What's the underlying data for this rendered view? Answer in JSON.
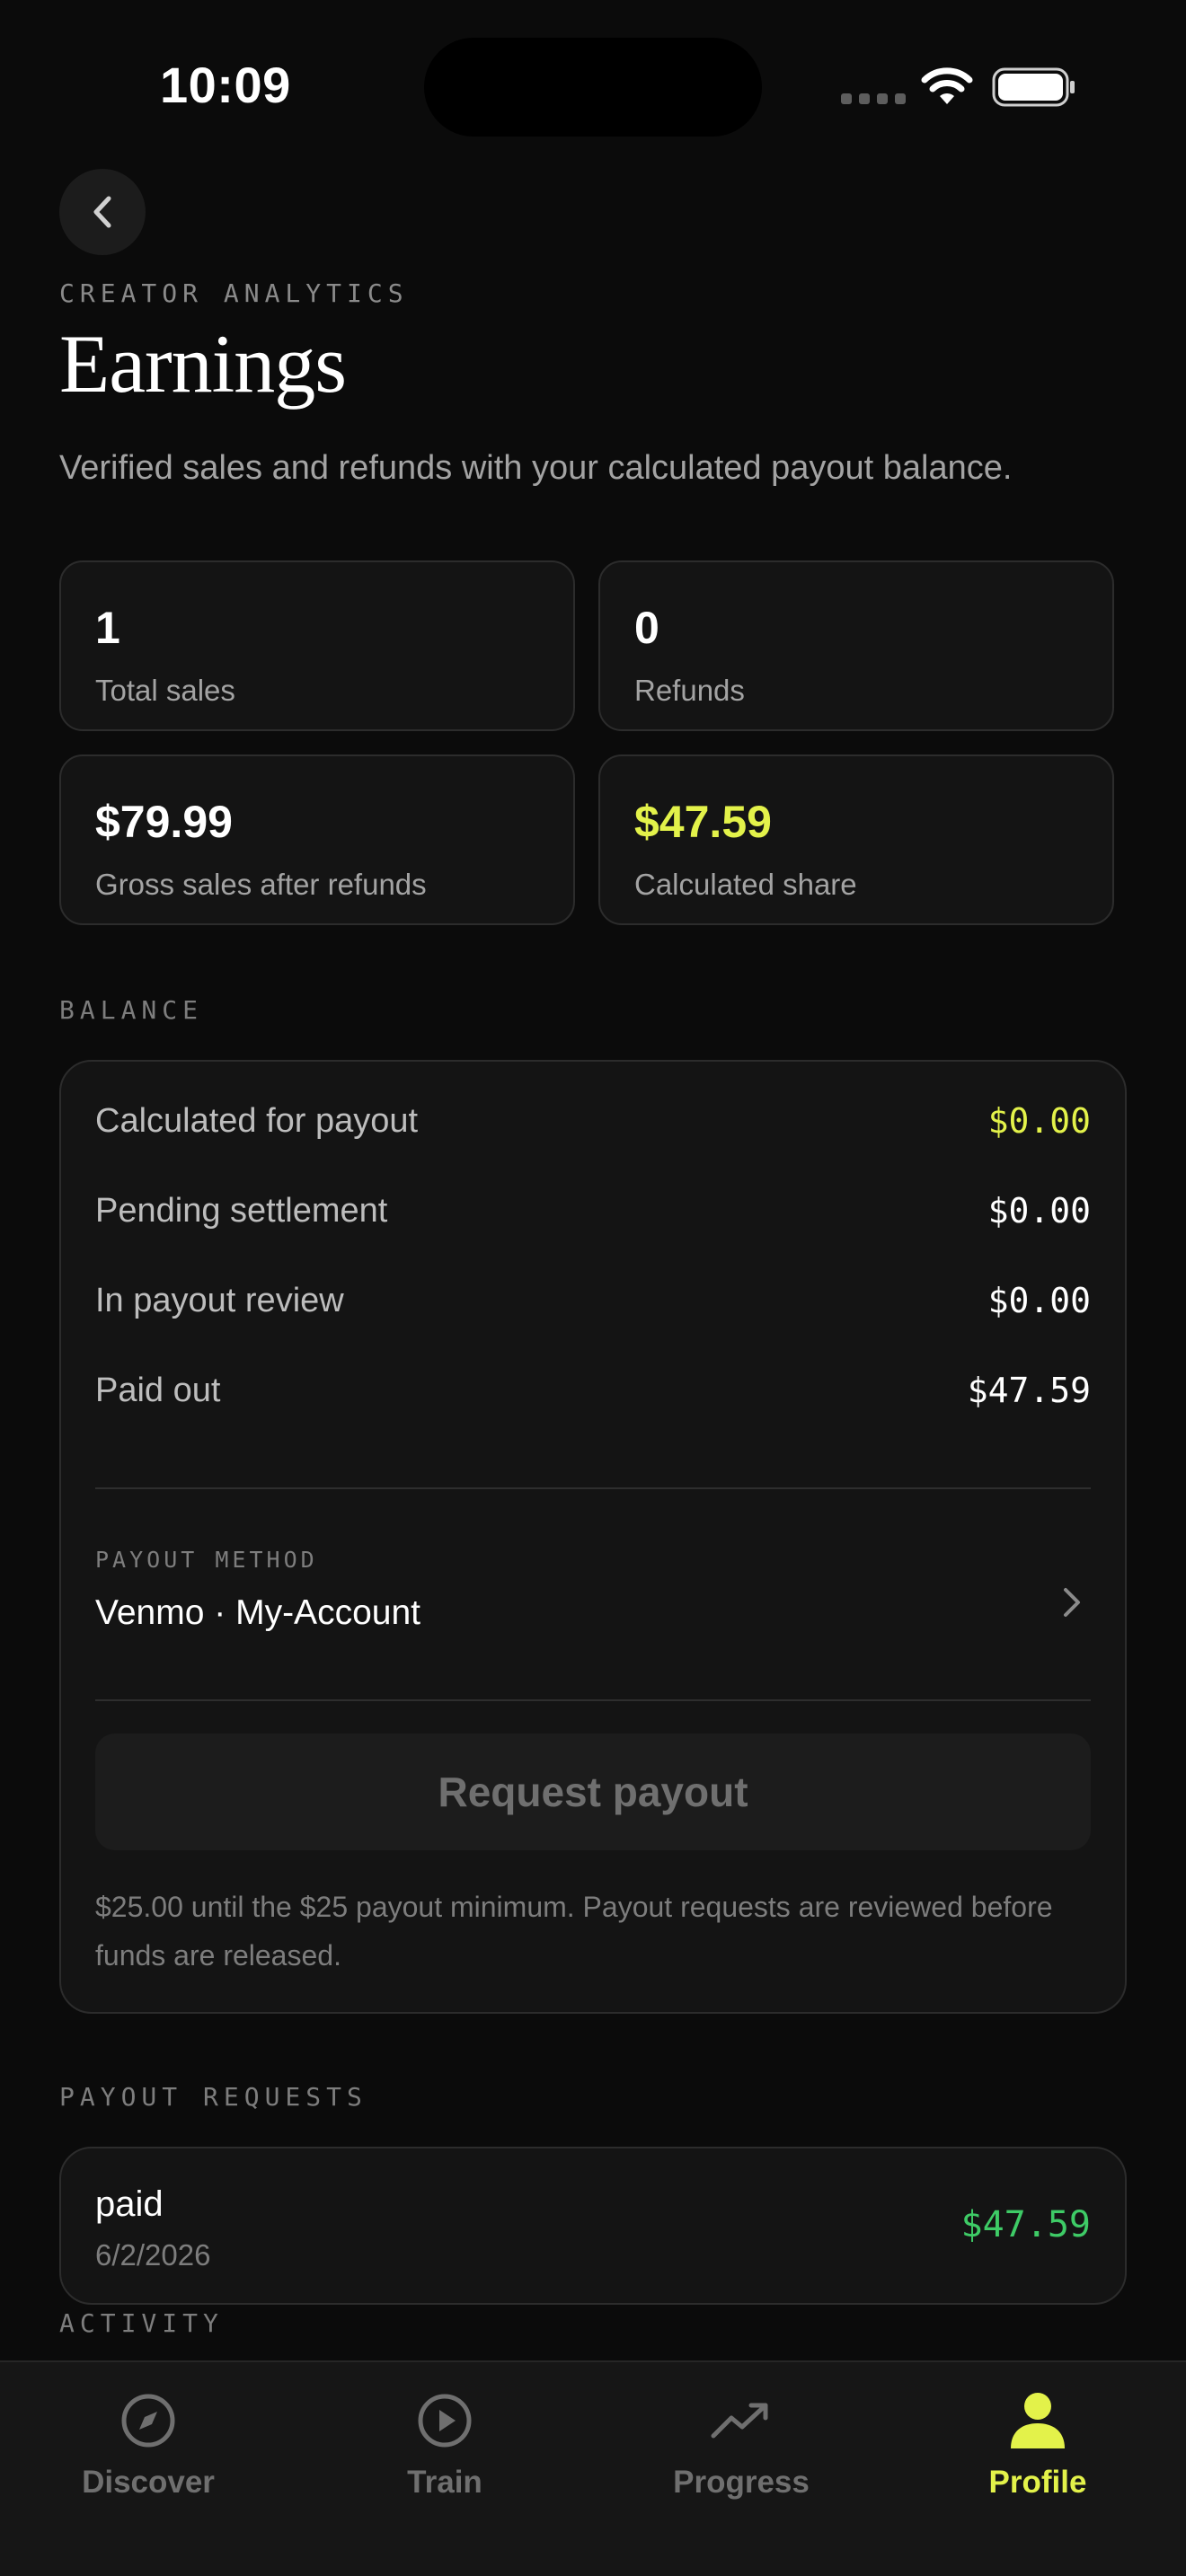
{
  "status_bar": {
    "time": "10:09"
  },
  "header": {
    "eyebrow": "CREATOR ANALYTICS",
    "title": "Earnings",
    "subtitle": "Verified sales and refunds with your calculated payout balance."
  },
  "stats": [
    {
      "value": "1",
      "label": "Total sales"
    },
    {
      "value": "0",
      "label": "Refunds"
    },
    {
      "value": "$79.99",
      "label": "Gross sales after refunds"
    },
    {
      "value": "$47.59",
      "label": "Calculated share"
    }
  ],
  "balance": {
    "section_label": "BALANCE",
    "rows": [
      {
        "label": "Calculated for payout",
        "value": "$0.00"
      },
      {
        "label": "Pending settlement",
        "value": "$0.00"
      },
      {
        "label": "In payout review",
        "value": "$0.00"
      },
      {
        "label": "Paid out",
        "value": "$47.59"
      }
    ],
    "payout_method_label": "PAYOUT METHOD",
    "payout_method_value": "Venmo · My-Account",
    "request_button": "Request payout",
    "note": "$25.00 until the $25 payout minimum. Payout requests are reviewed before funds are released."
  },
  "payout_requests": {
    "section_label": "PAYOUT REQUESTS",
    "items": [
      {
        "status": "paid",
        "date": "6/2/2026",
        "amount": "$47.59"
      }
    ]
  },
  "activity": {
    "section_label": "ACTIVITY"
  },
  "tabs": [
    {
      "label": "Discover",
      "icon": "compass-icon"
    },
    {
      "label": "Train",
      "icon": "play-circle-icon"
    },
    {
      "label": "Progress",
      "icon": "trending-up-icon"
    },
    {
      "label": "Profile",
      "icon": "person-icon",
      "active": true
    }
  ],
  "colors": {
    "accent": "#e3f24a",
    "positive": "#3ecb66",
    "background": "#0b0b0b"
  }
}
